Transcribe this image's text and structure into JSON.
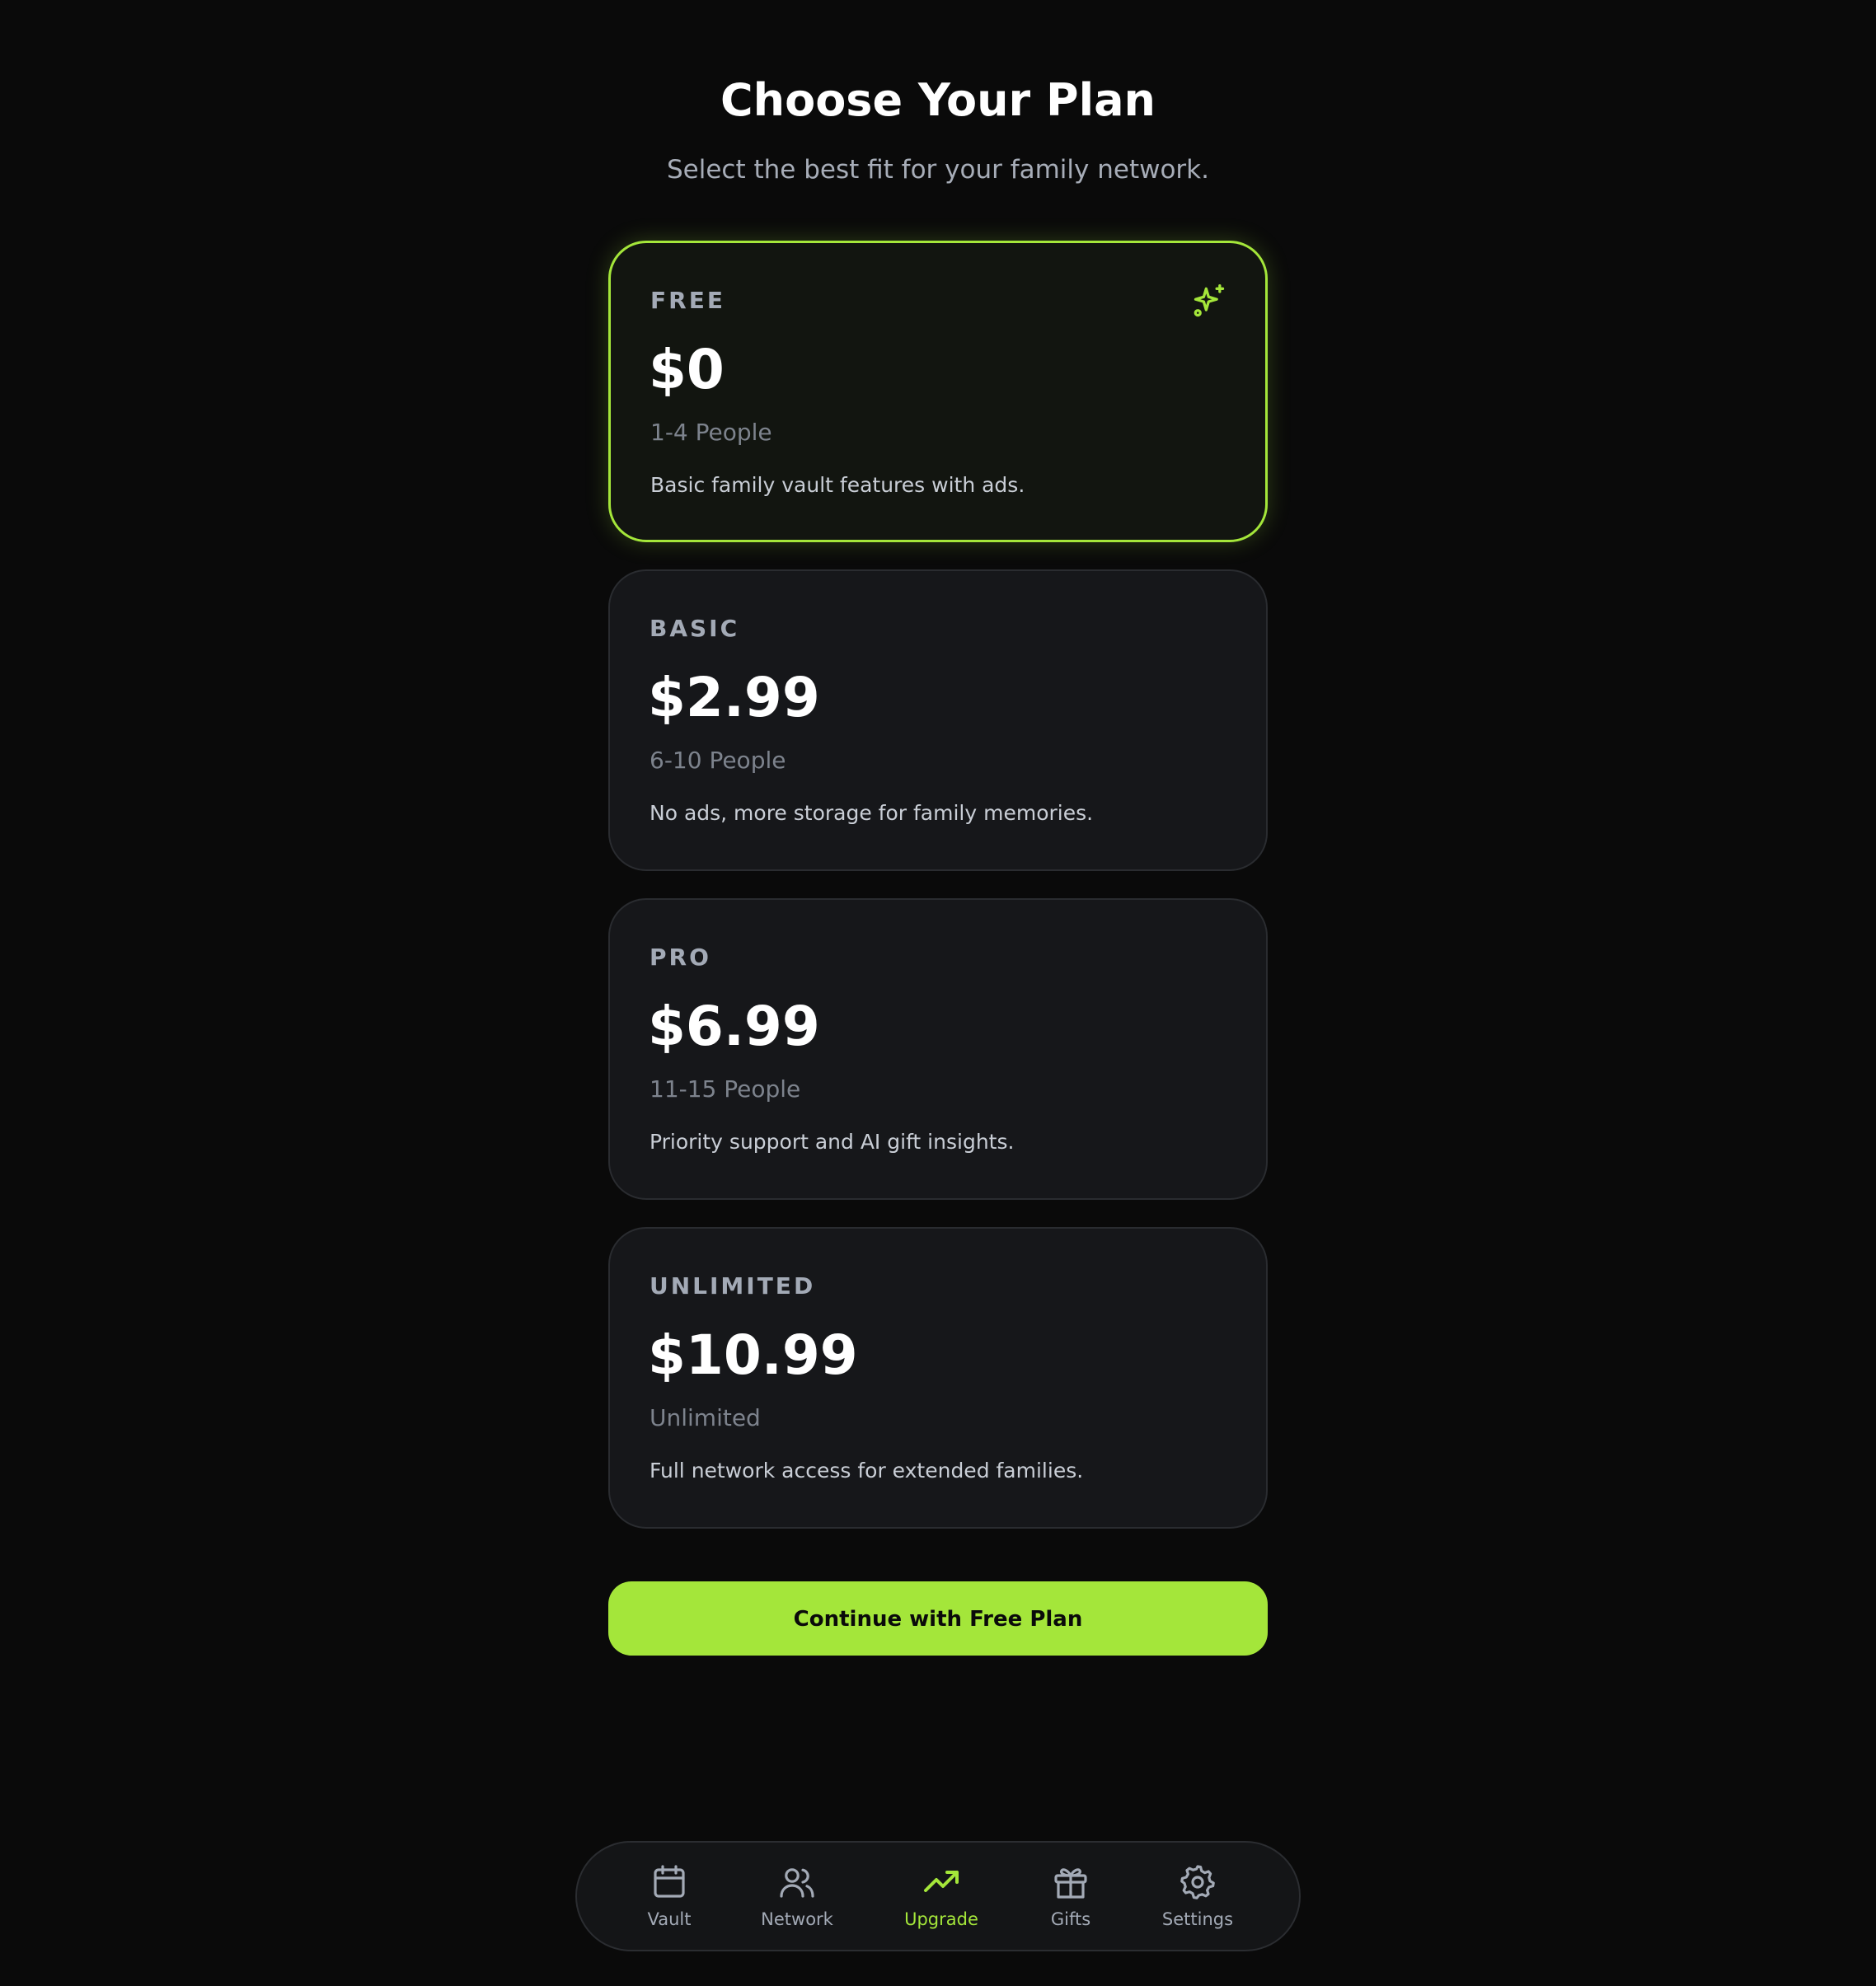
{
  "header": {
    "title": "Choose Your Plan",
    "subtitle": "Select the best fit for your family network."
  },
  "plans": [
    {
      "name": "FREE",
      "price": "$0",
      "people": "1-4 People",
      "description": "Basic family vault features with ads.",
      "selected": true,
      "icon": "sparkle-icon"
    },
    {
      "name": "BASIC",
      "price": "$2.99",
      "people": "6-10 People",
      "description": "No ads, more storage for family memories.",
      "selected": false
    },
    {
      "name": "PRO",
      "price": "$6.99",
      "people": "11-15 People",
      "description": "Priority support and AI gift insights.",
      "selected": false
    },
    {
      "name": "UNLIMITED",
      "price": "$10.99",
      "people": "Unlimited",
      "description": "Full network access for extended families.",
      "selected": false
    }
  ],
  "cta": {
    "label": "Continue with Free Plan"
  },
  "nav": {
    "items": [
      {
        "label": "Vault",
        "icon": "calendar-icon",
        "active": false
      },
      {
        "label": "Network",
        "icon": "users-icon",
        "active": false
      },
      {
        "label": "Upgrade",
        "icon": "trending-up-icon",
        "active": true
      },
      {
        "label": "Gifts",
        "icon": "gift-icon",
        "active": false
      },
      {
        "label": "Settings",
        "icon": "gear-icon",
        "active": false
      }
    ]
  },
  "colors": {
    "background": "#0a0a0a",
    "accent": "#a4e63a",
    "card": "#16171a",
    "muted_text": "#a3aab6"
  }
}
